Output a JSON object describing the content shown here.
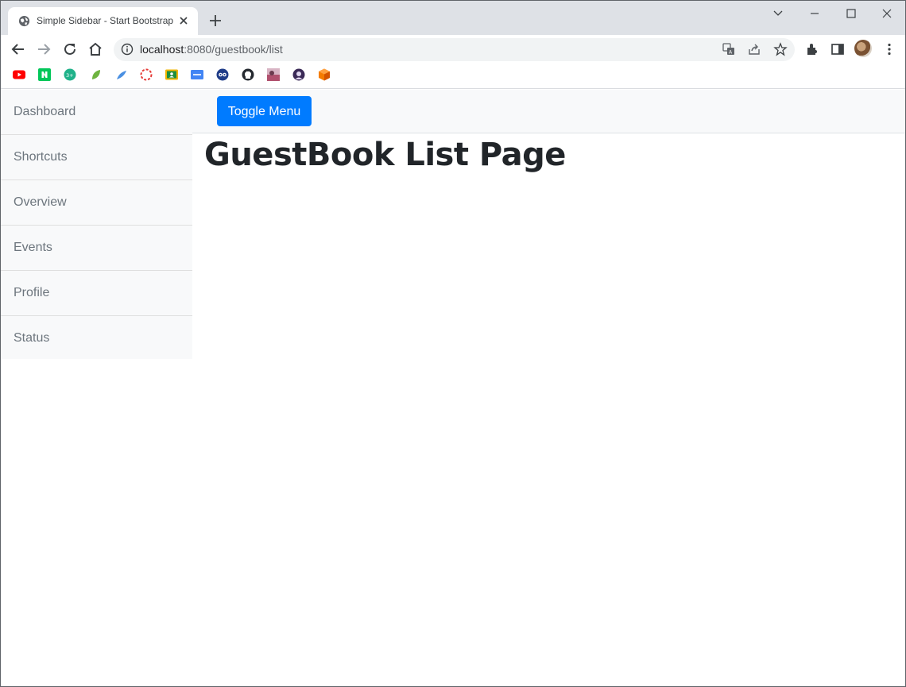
{
  "browser": {
    "tab": {
      "title": "Simple Sidebar - Start Bootstrap",
      "favicon": "globe-icon",
      "close_icon": "close-icon"
    },
    "new_tab_icon": "plus-icon",
    "window_controls": [
      "tab-search-icon",
      "minimize-icon",
      "maximize-icon",
      "close-icon"
    ],
    "toolbar": {
      "nav_icons": [
        "back-arrow-icon",
        "forward-arrow-icon",
        "reload-icon",
        "home-icon"
      ],
      "url_host": "localhost",
      "url_rest": ":8080/guestbook/list",
      "omnibox_icons": [
        "translate-icon",
        "share-icon",
        "bookmark-star-icon"
      ],
      "right_icons": [
        "extensions-icon",
        "side-panel-icon",
        "profile-avatar",
        "menu-kebab-icon"
      ]
    },
    "bookmarks": [
      {
        "icon": "youtube-icon",
        "color": "#ff0000"
      },
      {
        "icon": "naver-icon",
        "color": "#03c75a"
      },
      {
        "icon": "green-circle-icon",
        "color": "#20b28a"
      },
      {
        "icon": "leaf-icon",
        "color": "#6db33f"
      },
      {
        "icon": "feather-icon",
        "color": "#4a90e2"
      },
      {
        "icon": "lifebuoy-icon",
        "color": "#e53935"
      },
      {
        "icon": "classroom-icon",
        "color": "#f2b400"
      },
      {
        "icon": "blue-badge-icon",
        "color": "#4285f4"
      },
      {
        "icon": "owl-icon",
        "color": "#1f3c88"
      },
      {
        "icon": "github-icon",
        "color": "#24292f"
      },
      {
        "icon": "photo-icon",
        "color": "#b0506e"
      },
      {
        "icon": "avatar-round-icon",
        "color": "#3b2a57"
      },
      {
        "icon": "orange-cube-icon",
        "color": "#f57c00"
      }
    ]
  },
  "sidebar": {
    "items": [
      {
        "label": "Dashboard"
      },
      {
        "label": "Shortcuts"
      },
      {
        "label": "Overview"
      },
      {
        "label": "Events"
      },
      {
        "label": "Profile"
      },
      {
        "label": "Status"
      }
    ]
  },
  "topnav": {
    "toggle_label": "Toggle Menu",
    "toggle_color": "#007bff"
  },
  "main": {
    "title": "GuestBook List Page"
  }
}
